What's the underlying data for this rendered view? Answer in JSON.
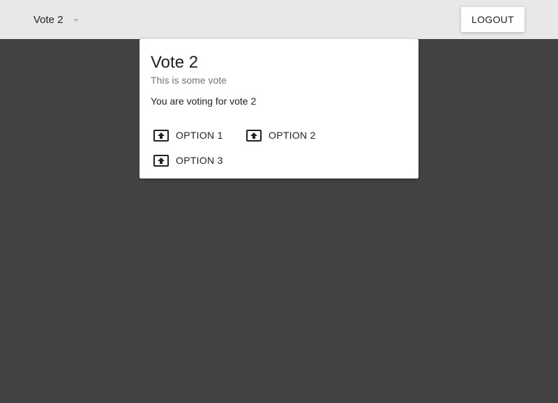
{
  "header": {
    "vote_select": {
      "selected": "Vote 2",
      "icon": "chevron-down-icon"
    },
    "logout_label": "LOGOUT"
  },
  "card": {
    "title": "Vote 2",
    "subtitle": "This is some vote",
    "text": "You are voting for vote 2",
    "options": [
      {
        "label": "OPTION 1",
        "icon": "upvote-icon"
      },
      {
        "label": "OPTION 2",
        "icon": "upvote-icon"
      },
      {
        "label": "OPTION 3",
        "icon": "upvote-icon"
      }
    ]
  },
  "colors": {
    "appbar": "#e8e8e8",
    "background": "#424242",
    "card": "#ffffff",
    "text": "#212121",
    "subtitle": "#757575"
  }
}
